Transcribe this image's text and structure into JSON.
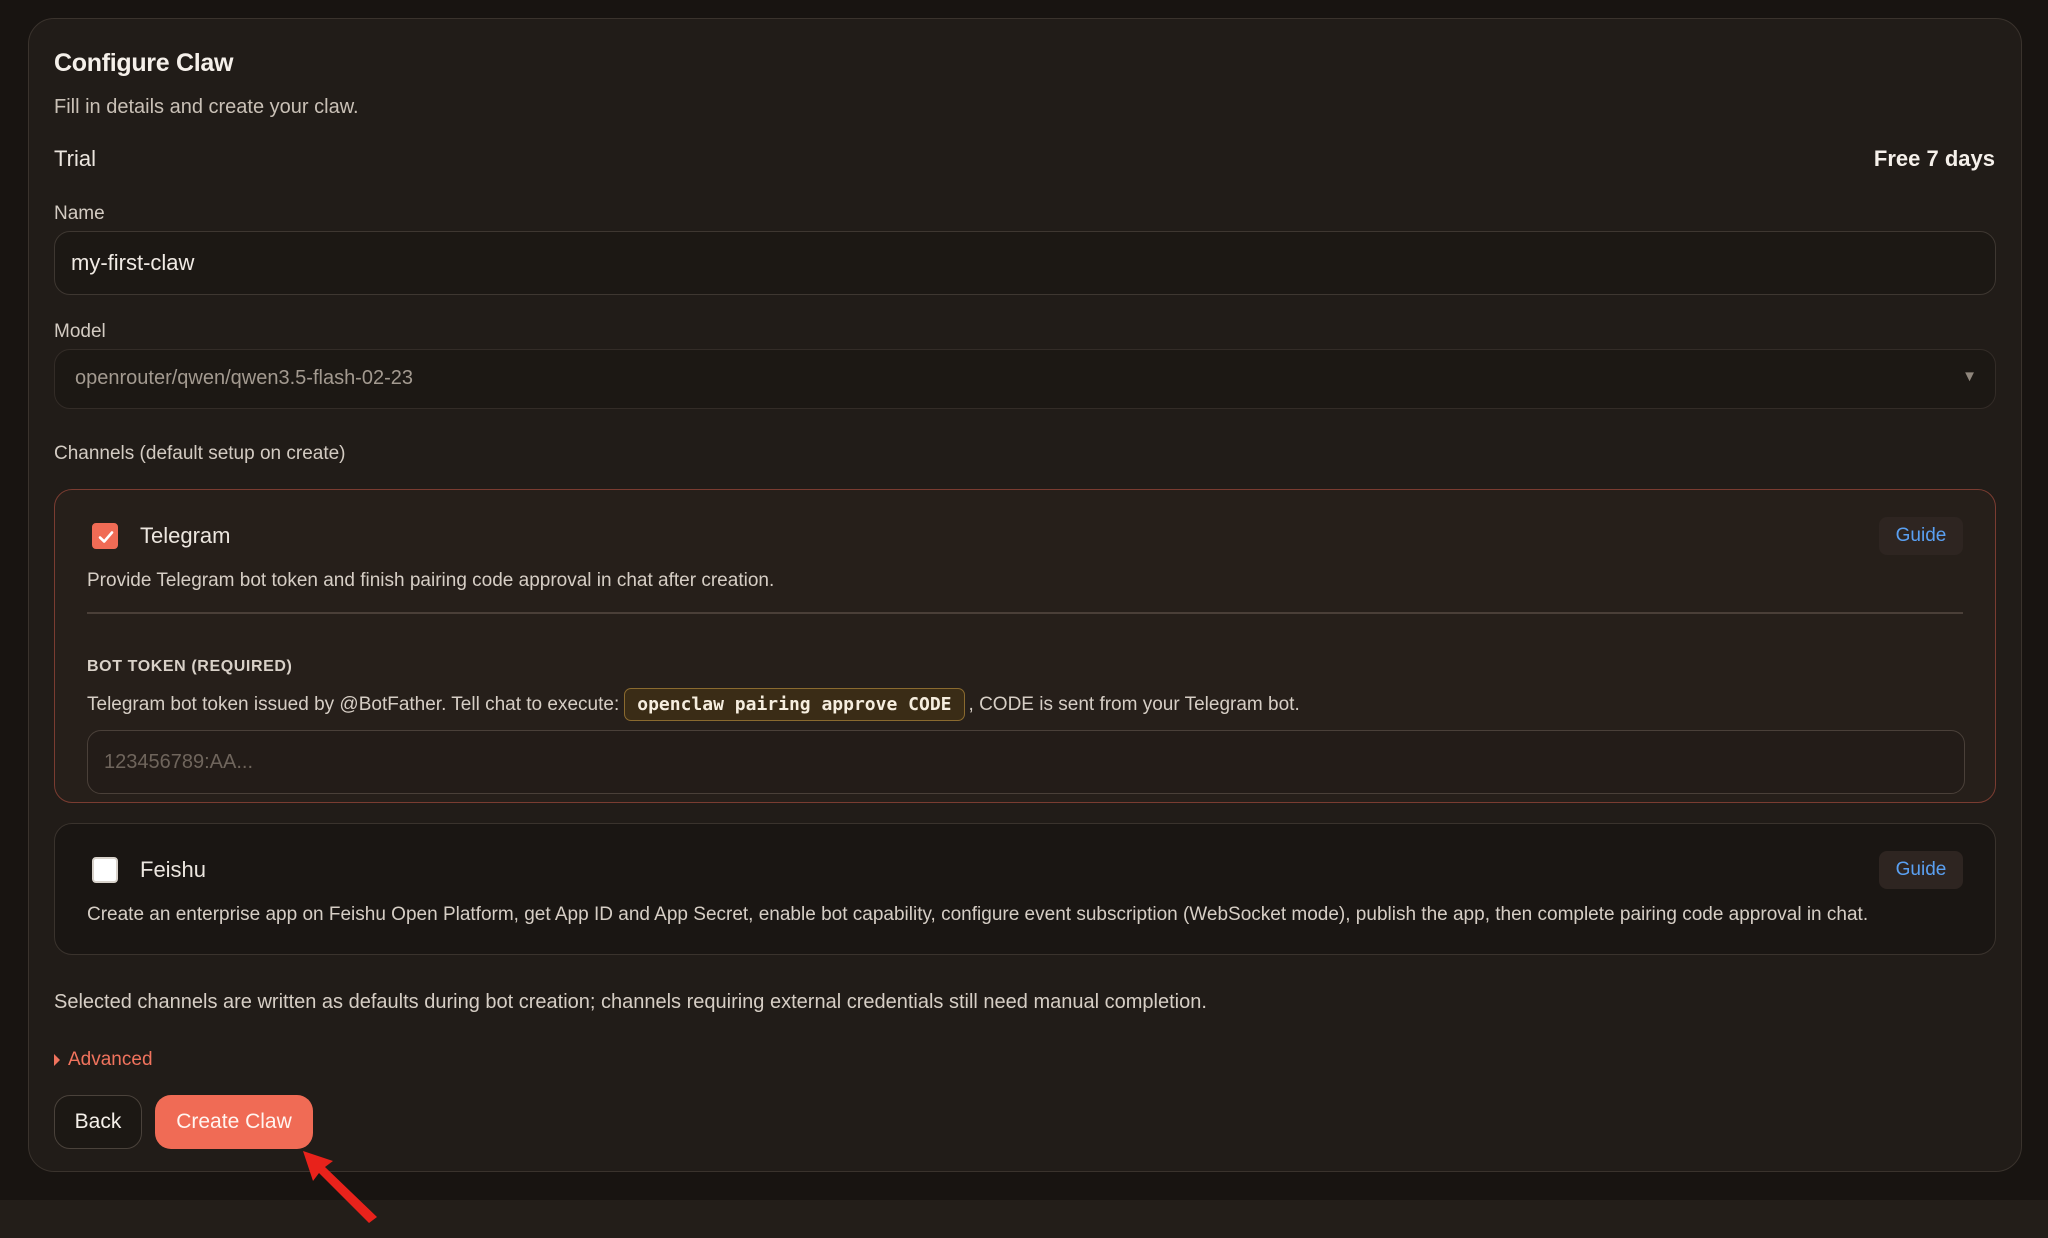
{
  "form": {
    "title": "Configure Claw",
    "subtitle": "Fill in details and create your claw.",
    "trial": {
      "label": "Trial",
      "value": "Free 7 days"
    },
    "name": {
      "label": "Name",
      "value": "my-first-claw"
    },
    "model": {
      "label": "Model",
      "value": "openrouter/qwen/qwen3.5-flash-02-23"
    },
    "channels_label": "Channels (default setup on create)"
  },
  "channels": {
    "telegram": {
      "name": "Telegram",
      "checked": true,
      "guide_label": "Guide",
      "description": "Provide Telegram bot token and finish pairing code approval in chat after creation.",
      "token_heading": "BOT TOKEN (REQUIRED)",
      "token_help_before": "Telegram bot token issued by @BotFather. Tell chat to execute:",
      "token_help_code": "openclaw pairing approve CODE",
      "token_help_after": ", CODE is sent from your Telegram bot.",
      "token_placeholder": "123456789:AA..."
    },
    "feishu": {
      "name": "Feishu",
      "checked": false,
      "guide_label": "Guide",
      "description": "Create an enterprise app on Feishu Open Platform, get App ID and App Secret, enable bot capability, configure event subscription (WebSocket mode), publish the app, then complete pairing code approval in chat."
    }
  },
  "footnote": "Selected channels are written as defaults during bot creation; channels requiring external credentials still need manual completion.",
  "advanced_label": "Advanced",
  "buttons": {
    "back": "Back",
    "create": "Create Claw"
  },
  "colors": {
    "accent": "#f06b55",
    "link": "#5aa0f2",
    "annotation_arrow": "#e8221b"
  },
  "icons": {
    "checkbox_checked": "check-icon",
    "model_select": "caret-down-icon",
    "advanced": "caret-right-icon",
    "annotation": "pointer-arrow-icon"
  }
}
